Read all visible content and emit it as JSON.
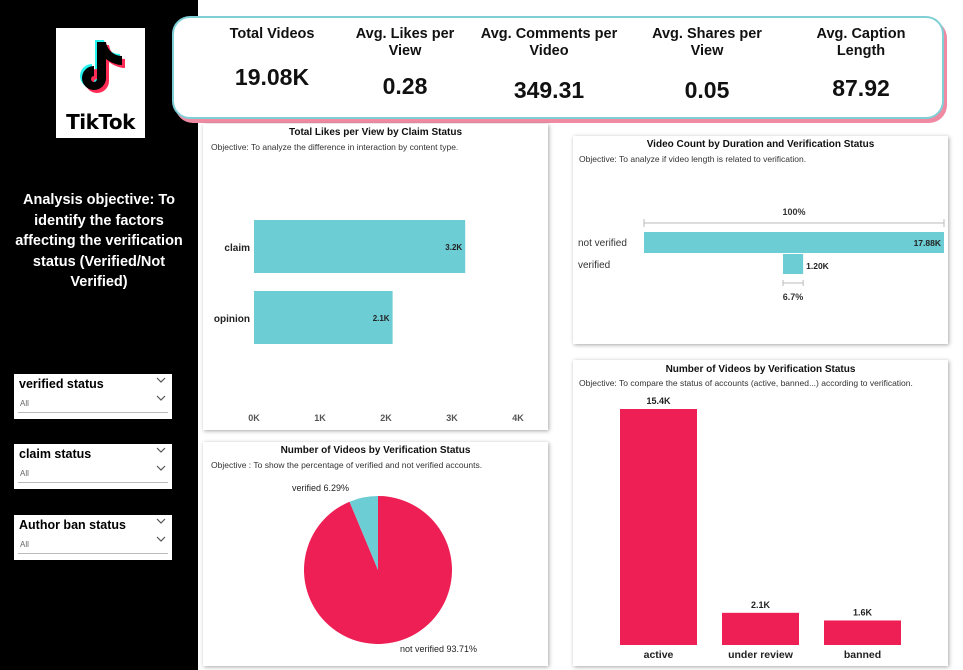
{
  "sidebar": {
    "logo_text": "TikTok",
    "objective_text": "Analysis objective: To identify the factors affecting the verification status (Verified/Not Verified)",
    "slicers": [
      {
        "title": "verified status",
        "value": "All"
      },
      {
        "title": "claim status",
        "value": "All"
      },
      {
        "title": "Author ban status",
        "value": "All"
      }
    ]
  },
  "kpis": [
    {
      "label": "Total Videos",
      "value": "19.08K"
    },
    {
      "label": "Avg. Likes per View",
      "value": "0.28"
    },
    {
      "label": "Avg. Comments per Video",
      "value": "349.31"
    },
    {
      "label": "Avg. Shares per View",
      "value": "0.05"
    },
    {
      "label": "Avg. Caption Length",
      "value": "87.92"
    }
  ],
  "colors": {
    "teal": "#6ccdd4",
    "pink": "#ee1f55",
    "sidebar": "#000000"
  },
  "chart_data": [
    {
      "type": "bar",
      "orientation": "horizontal",
      "title": "Total Likes per View by Claim Status",
      "subtitle": "Objective: To analyze the difference in interaction by content type.",
      "categories": [
        "claim",
        "opinion"
      ],
      "values": [
        3200,
        2100
      ],
      "data_labels": [
        "3.2K",
        "2.1K"
      ],
      "xlim": [
        0,
        4000
      ],
      "x_ticks": [
        0,
        1000,
        2000,
        3000,
        4000
      ],
      "x_tick_labels": [
        "0K",
        "1K",
        "2K",
        "3K",
        "4K"
      ]
    },
    {
      "type": "bar",
      "orientation": "horizontal",
      "title": "Video Count by Duration and Verification Status",
      "subtitle": "Objective: To analyze if video length is related to verification.",
      "categories": [
        "not verified",
        "verified"
      ],
      "values": [
        17880,
        1200
      ],
      "data_labels": [
        "17.88K",
        "1.20K"
      ],
      "top_annotation": "100%",
      "bottom_annotation": "6.7%"
    },
    {
      "type": "pie",
      "title": "Number of Videos by Verification Status",
      "subtitle": "Objective : To show the percentage of verified and not verified accounts.",
      "labels": [
        "not verified",
        "verified"
      ],
      "values": [
        93.71,
        6.29
      ],
      "data_labels": [
        "not verified 93.71%",
        "verified 6.29%"
      ]
    },
    {
      "type": "bar",
      "orientation": "vertical",
      "title": "Number of Videos by Verification Status",
      "subtitle": "Objective: To compare the status of accounts (active, banned...) according to verification.",
      "categories": [
        "active",
        "under review",
        "banned"
      ],
      "values": [
        15400,
        2100,
        1600
      ],
      "data_labels": [
        "15.4K",
        "2.1K",
        "1.6K"
      ]
    }
  ]
}
